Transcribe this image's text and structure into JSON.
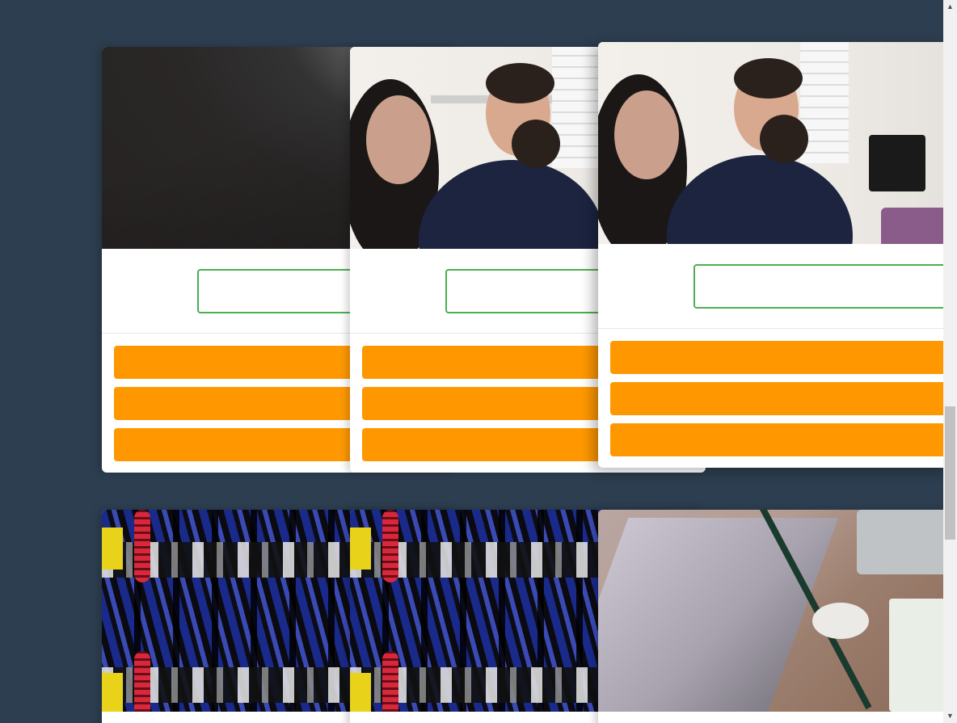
{
  "colors": {
    "page_background": "#2c3e50",
    "outline_button_border": "#4caf50",
    "action_button": "#ff9800",
    "card_background": "#ffffff"
  },
  "cards": [
    {
      "image": "dark-textured-surface-photo",
      "outline_button_label": "",
      "actions": [
        "",
        "",
        ""
      ]
    },
    {
      "image": "office-meeting-photo",
      "outline_button_label": "",
      "actions": [
        "",
        "",
        ""
      ]
    },
    {
      "image": "office-meeting-photo",
      "outline_button_label": "",
      "actions": [
        "",
        "",
        ""
      ]
    },
    {
      "image": "mechanical-springs-photo"
    },
    {
      "image": "mechanical-springs-photo"
    },
    {
      "image": "laptop-desk-photo"
    }
  ],
  "scrollbar": {
    "up_icon": "scroll-up-arrow-icon",
    "down_icon": "scroll-down-arrow-icon"
  }
}
